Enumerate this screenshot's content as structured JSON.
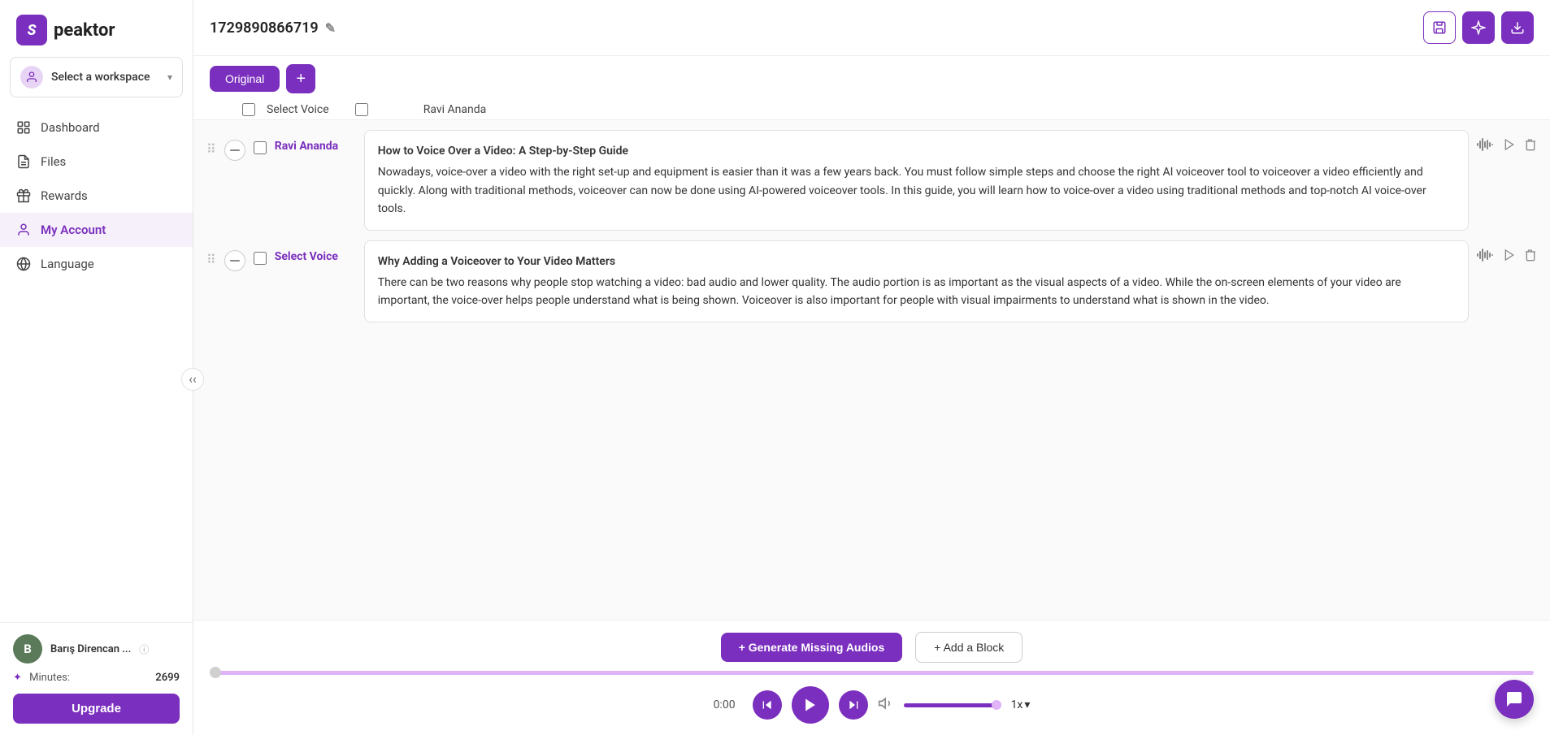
{
  "sidebar": {
    "logo_letter": "S",
    "logo_text": "peaktor",
    "workspace": {
      "label": "Select a workspace",
      "icon": "👤"
    },
    "nav": [
      {
        "id": "dashboard",
        "label": "Dashboard",
        "icon": "dashboard"
      },
      {
        "id": "files",
        "label": "Files",
        "icon": "files"
      },
      {
        "id": "rewards",
        "label": "Rewards",
        "icon": "rewards"
      },
      {
        "id": "my-account",
        "label": "My Account",
        "icon": "account"
      },
      {
        "id": "language",
        "label": "Language",
        "icon": "language"
      }
    ],
    "user": {
      "name": "Barış Direncan ...",
      "avatar_letter": "B"
    },
    "minutes": {
      "label": "Minutes:",
      "count": "2699"
    },
    "upgrade_label": "Upgrade"
  },
  "header": {
    "file_id": "1729890866719",
    "actions": {
      "save_icon": "💾",
      "settings_icon": "✨",
      "download_icon": "⬇"
    }
  },
  "tabs": {
    "original_label": "Original",
    "add_label": "+"
  },
  "voice_columns": {
    "col1": "Select Voice",
    "col2": "Ravi Ananda"
  },
  "blocks": [
    {
      "id": "block-1",
      "voice": "Ravi Ananda",
      "title": "How to Voice Over a Video: A Step-by-Step Guide",
      "content": "Nowadays, voice-over a video with the right set-up and equipment is easier than it was a few years back. You must follow simple steps and choose the right AI voiceover tool to voiceover a video efficiently and quickly. Along with traditional methods, voiceover can now be done using AI-powered voiceover tools. In this guide, you will learn how to voice-over a video using traditional methods and top-notch AI voice-over tools."
    },
    {
      "id": "block-2",
      "voice": "Select Voice",
      "title": "Why Adding a Voiceover to Your Video Matters",
      "content": "There can be two reasons why people stop watching a video: bad audio and lower quality. The audio portion is as important as the visual aspects of a video. While the on-screen elements of your video are important, the voice-over helps people understand what is being shown. Voiceover is also important for people with visual impairments to understand what is shown in the video."
    }
  ],
  "bottom": {
    "generate_btn": "+ Generate Missing Audios",
    "add_block_btn": "+ Add a Block",
    "time": "0:00",
    "speed": "1x"
  }
}
